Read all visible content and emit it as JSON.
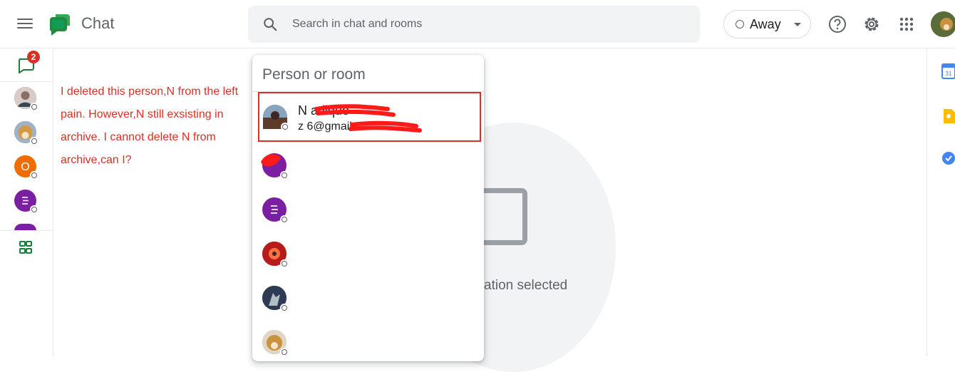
{
  "header": {
    "app_title": "Chat",
    "search_placeholder": "Search in chat and rooms",
    "status_label": "Away"
  },
  "left_rail": {
    "chat_badge_count": "2",
    "avatars": [
      {
        "kind": "photo",
        "color": "#6d4c41"
      },
      {
        "kind": "photo",
        "color": "#c8923f"
      },
      {
        "kind": "letter",
        "letter": "O",
        "color": "#ef6c00"
      },
      {
        "kind": "letter",
        "letter": "≡",
        "color": "#7b1fa2"
      },
      {
        "kind": "letter",
        "letter": "",
        "color": "#7b1fa2"
      }
    ]
  },
  "annotation_note": "I deleted this person,N from the left pain. However,N still exsisting in archive. I cannot delete N from archive,can I?",
  "main": {
    "empty_state_text": "ation selected"
  },
  "popup": {
    "input_placeholder": "Person or room",
    "results": [
      {
        "name": "N       adique",
        "email": "z                  6@gmail.c…",
        "avatar_color": "#4a5a6a",
        "highlighted": true
      },
      {
        "name": "",
        "email": "",
        "avatar_color": "#7b1fa2"
      },
      {
        "name": "",
        "email": "",
        "avatar_color": "#7b1fa2"
      },
      {
        "name": "",
        "email": "",
        "avatar_color": "#c62828"
      },
      {
        "name": "",
        "email": "",
        "avatar_color": "#3f4a6b"
      },
      {
        "name": "",
        "email": "",
        "avatar_color": "#c8923f"
      }
    ]
  },
  "colors": {
    "accent_green": "#188038",
    "badge_red": "#d93025",
    "annotation_red": "#d93025"
  },
  "icons": [
    "menu-icon",
    "chat-logo-icon",
    "search-icon",
    "help-icon",
    "settings-icon",
    "apps-grid-icon",
    "calendar-icon",
    "keep-icon",
    "tasks-icon",
    "spaces-icon"
  ]
}
